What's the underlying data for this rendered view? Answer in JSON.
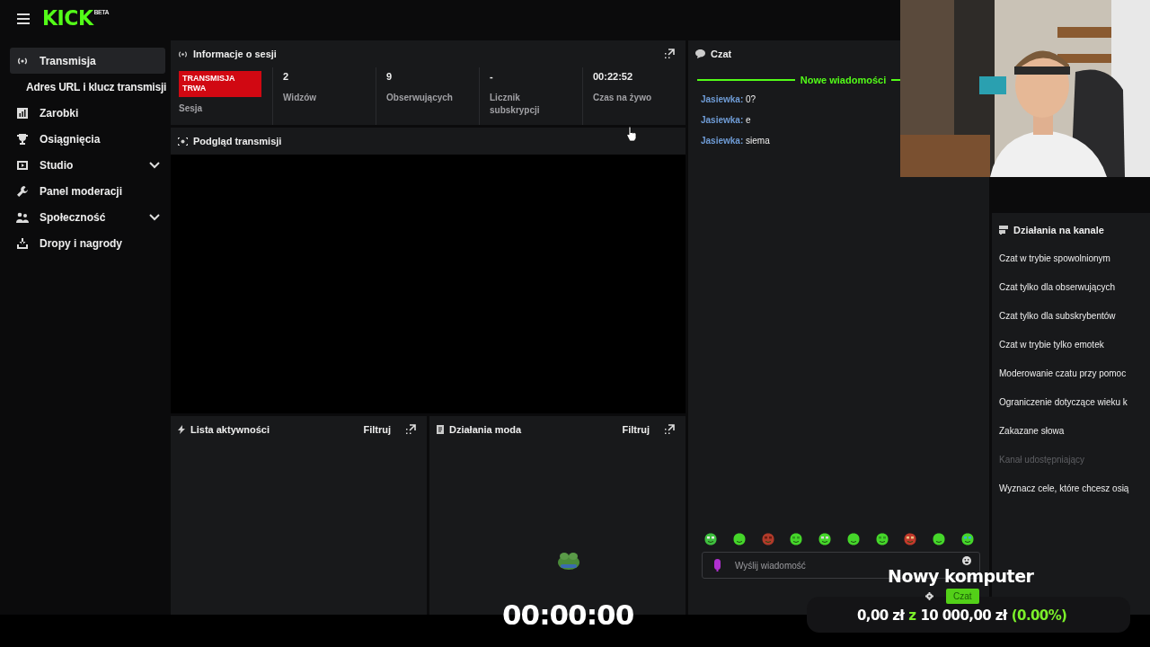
{
  "topbar": {
    "logo": "KICK",
    "logo_badge": "BETA"
  },
  "sidebar": {
    "items": [
      {
        "label": "Transmisja",
        "selected": true,
        "children": [
          {
            "label": "Adres URL i klucz transmisji",
            "selected": false
          }
        ]
      },
      {
        "label": "Zarobki",
        "selected": false
      },
      {
        "label": "Osiągnięcia",
        "selected": false
      },
      {
        "label": "Studio",
        "selected": false,
        "expanded": false
      },
      {
        "label": "Panel moderacji",
        "selected": false
      },
      {
        "label": "Społeczność",
        "selected": false,
        "expanded": false
      },
      {
        "label": "Dropy i nagrody",
        "selected": false
      }
    ]
  },
  "session_info": {
    "title": "Informacje o sesji",
    "status": {
      "text": "TRANSMISJA TRWA",
      "label": "Sesja"
    },
    "stats": [
      {
        "value": "2",
        "label": "Widzów"
      },
      {
        "value": "9",
        "label": "Obserwujących"
      },
      {
        "value": "-",
        "label": "Licznik subskrypcji"
      },
      {
        "value": "00:22:52",
        "label": "Czas na żywo"
      }
    ]
  },
  "preview": {
    "title": "Podgląd transmisji"
  },
  "activity": {
    "title": "Lista aktywności",
    "filter": "Filtruj"
  },
  "mod_actions": {
    "title": "Działania moda",
    "filter": "Filtruj"
  },
  "chat": {
    "title": "Czat",
    "divider": "Nowe wiadomości",
    "messages": [
      {
        "user": "Jasiewka:",
        "text": "0?"
      },
      {
        "user": "Jasiewka:",
        "text": "e"
      },
      {
        "user": "Jasiewka:",
        "text": "siema"
      }
    ],
    "placeholder": "Wyślij wiadomość"
  },
  "channel_actions": {
    "title": "Działania na kanale",
    "items": [
      {
        "label": "Czat w trybie spowolnionym",
        "disabled": false
      },
      {
        "label": "Czat tylko dla obserwujących",
        "disabled": false
      },
      {
        "label": "Czat tylko dla subskrybentów",
        "disabled": false
      },
      {
        "label": "Czat w trybie tylko emotek",
        "disabled": false
      },
      {
        "label": "Moderowanie czatu przy pomoc",
        "disabled": false
      },
      {
        "label": "Ograniczenie dotyczące wieku k",
        "disabled": false
      },
      {
        "label": "Zakazane słowa",
        "disabled": false
      },
      {
        "label": "Kanał udostępniający",
        "disabled": true
      },
      {
        "label": "Wyznacz cele, które chcesz osią",
        "disabled": false
      }
    ]
  },
  "overlay": {
    "timer": "00:00:00",
    "goal": {
      "title": "Nowy komputer",
      "chat_button": "Czat",
      "raised": "0,00 zł",
      "separator": "z",
      "target": "10 000,00 zł",
      "percent": "(0.00%)"
    }
  }
}
